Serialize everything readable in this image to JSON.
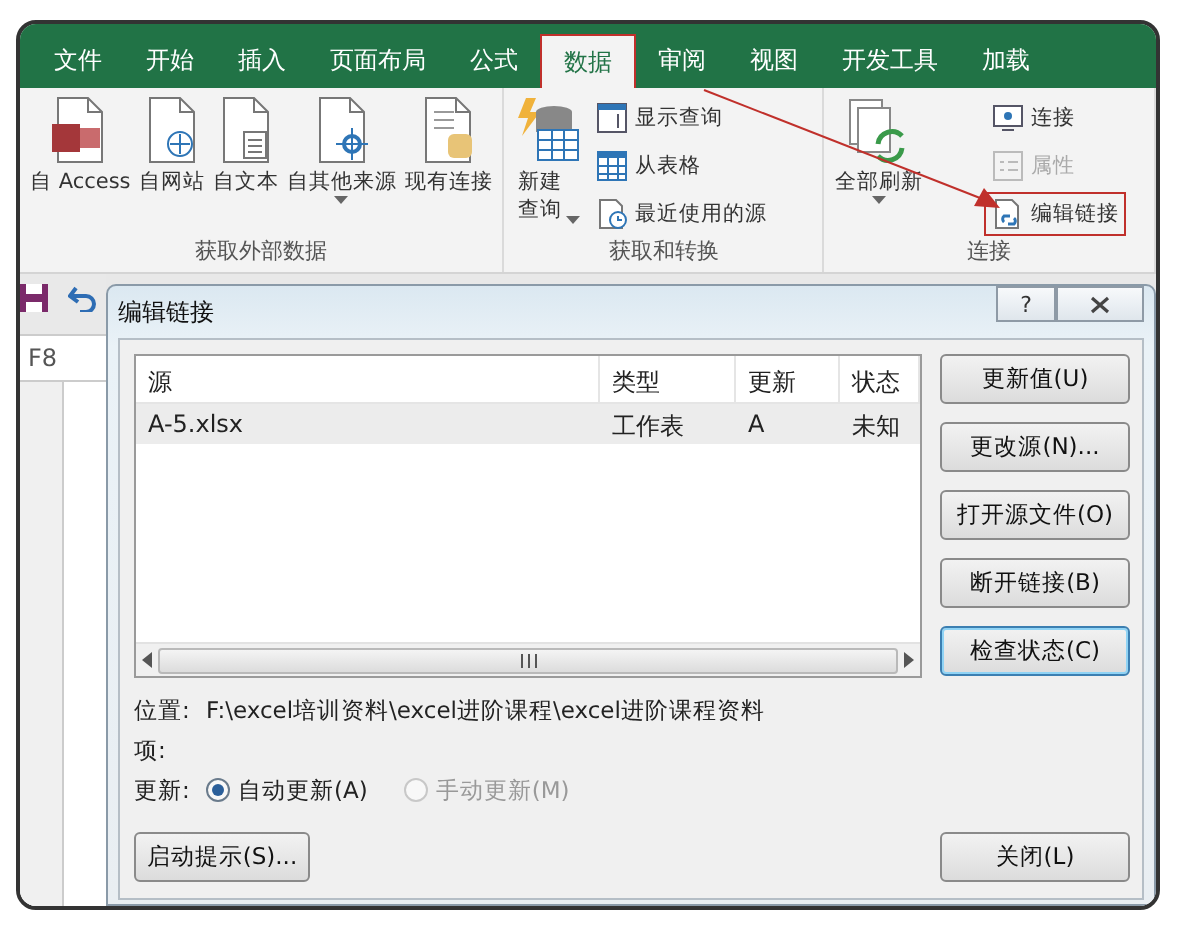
{
  "ribbon_tabs": [
    {
      "label": "文件",
      "selected": false
    },
    {
      "label": "开始",
      "selected": false
    },
    {
      "label": "插入",
      "selected": false
    },
    {
      "label": "页面布局",
      "selected": false
    },
    {
      "label": "公式",
      "selected": false
    },
    {
      "label": "数据",
      "selected": true
    },
    {
      "label": "审阅",
      "selected": false
    },
    {
      "label": "视图",
      "selected": false
    },
    {
      "label": "开发工具",
      "selected": false
    },
    {
      "label": "加载",
      "selected": false
    }
  ],
  "ribbon_groups": [
    {
      "label": "获取外部数据",
      "items": [
        {
          "kind": "large",
          "label": "自 Access"
        },
        {
          "kind": "large",
          "label": "自网站"
        },
        {
          "kind": "large",
          "label": "自文本"
        },
        {
          "kind": "large-caret",
          "label": "自其他来源"
        },
        {
          "kind": "large",
          "label": "现有连接"
        }
      ]
    },
    {
      "label": "获取和转换",
      "items": [
        {
          "kind": "large-split",
          "label": "新建查询"
        },
        {
          "kind": "small",
          "label": "显示查询",
          "disabled": false,
          "highlighted": false
        },
        {
          "kind": "small",
          "label": "从表格",
          "disabled": false,
          "highlighted": false
        },
        {
          "kind": "small",
          "label": "最近使用的源",
          "disabled": false,
          "highlighted": false
        }
      ]
    },
    {
      "label": "连接",
      "items": [
        {
          "kind": "large-caret",
          "label": "全部刷新"
        },
        {
          "kind": "small",
          "label": "连接",
          "disabled": false,
          "highlighted": false
        },
        {
          "kind": "small",
          "label": "属性",
          "disabled": true,
          "highlighted": false
        },
        {
          "kind": "small",
          "label": "编辑链接",
          "disabled": false,
          "highlighted": true
        }
      ]
    }
  ],
  "name_box": "F8",
  "dialog": {
    "title": "编辑链接",
    "help": "?",
    "columns": [
      "源",
      "类型",
      "更新",
      "状态"
    ],
    "rows": [
      {
        "cells": [
          "A-5.xlsx",
          "工作表",
          "A",
          "未知"
        ],
        "selected": true
      }
    ],
    "side_buttons": [
      {
        "label": "更新值(U)",
        "default": false
      },
      {
        "label": "更改源(N)...",
        "default": false
      },
      {
        "label": "打开源文件(O)",
        "default": false
      },
      {
        "label": "断开链接(B)",
        "default": false
      },
      {
        "label": "检查状态(C)",
        "default": true
      }
    ],
    "location_label": "位置:",
    "location": "F:\\excel培训资料\\excel进阶课程\\excel进阶课程资料",
    "item_label": "项:",
    "update_label": "更新:",
    "update_options": [
      {
        "label": "自动更新(A)",
        "selected": true,
        "disabled": false
      },
      {
        "label": "手动更新(M)",
        "selected": false,
        "disabled": true
      }
    ],
    "startup_button": "启动提示(S)...",
    "close_button": "关闭(L)"
  }
}
